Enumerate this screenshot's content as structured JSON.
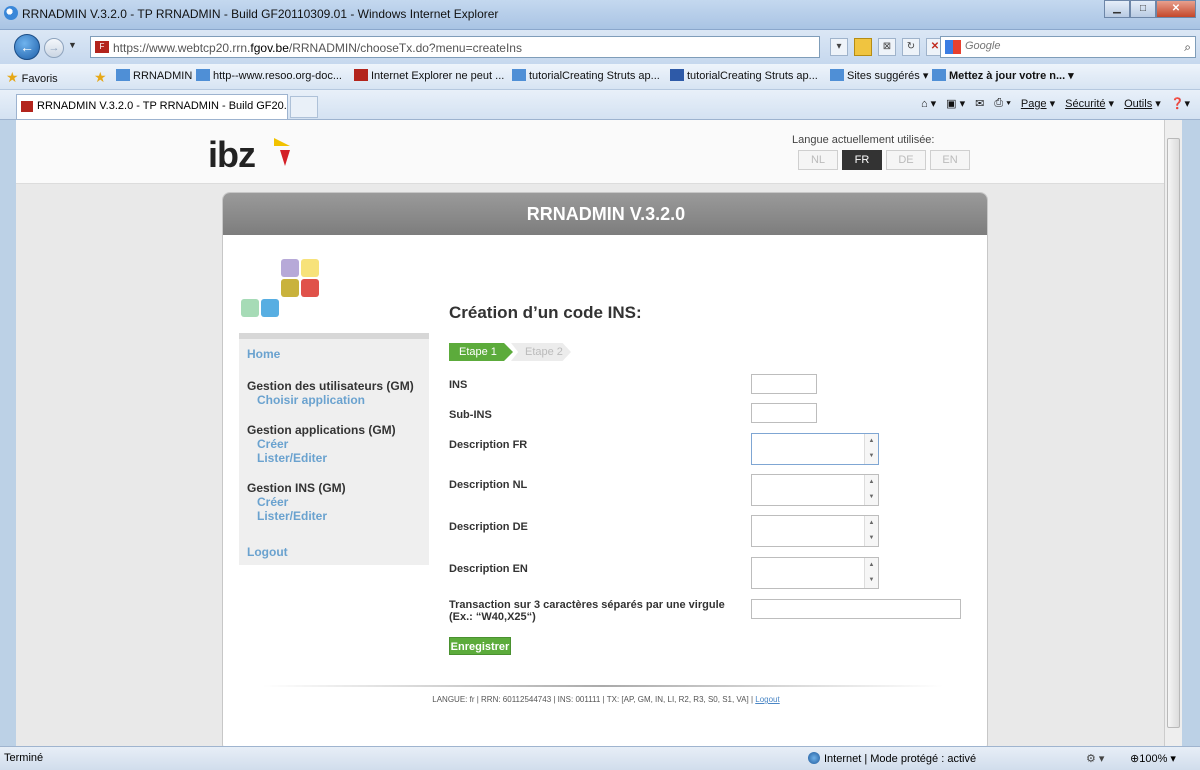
{
  "window": {
    "title": "RRNADMIN V.3.2.0 - TP RRNADMIN - Build GF20110309.01 - Windows Internet Explorer"
  },
  "address": {
    "url_prefix": "https://www.webtcp20.rrn.",
    "url_domain": "fgov.be",
    "url_suffix": "/RRNADMIN/chooseTx.do?menu=createIns",
    "search_placeholder": "Google"
  },
  "favorites": {
    "label": "Favoris",
    "items": [
      "RRNADMIN",
      "http--www.resoo.org-doc...",
      "Internet Explorer ne peut ...",
      "tutorialCreating Struts ap...",
      "tutorialCreating Struts ap...",
      "Sites suggérés ▾",
      "Mettez à jour votre n... ▾"
    ]
  },
  "tab": {
    "label": "RRNADMIN V.3.2.0 - TP RRNADMIN - Build GF20..."
  },
  "commandbar": {
    "page": "Page",
    "security": "Sécurité",
    "tools": "Outils"
  },
  "language": {
    "label": "Langue actuellement utilisée:",
    "options": [
      "NL",
      "FR",
      "DE",
      "EN"
    ],
    "active": "FR"
  },
  "panel": {
    "title": "RRNADMIN V.3.2.0"
  },
  "sidebar": {
    "home": "Home",
    "groups": [
      {
        "heading": "Gestion des utilisateurs (GM)",
        "links": [
          "Choisir application"
        ]
      },
      {
        "heading": "Gestion applications (GM)",
        "links": [
          "Créer",
          "Lister/Editer"
        ]
      },
      {
        "heading": "Gestion INS (GM)",
        "links": [
          "Créer",
          "Lister/Editer"
        ]
      }
    ],
    "logout": "Logout"
  },
  "form": {
    "title": "Création d’un code INS:",
    "steps": [
      "Etape 1",
      "Etape 2"
    ],
    "fields": {
      "ins": {
        "label": "INS",
        "value": ""
      },
      "sub_ins": {
        "label": "Sub-INS",
        "value": ""
      },
      "desc_fr": {
        "label": "Description FR",
        "value": ""
      },
      "desc_nl": {
        "label": "Description NL",
        "value": ""
      },
      "desc_de": {
        "label": "Description DE",
        "value": ""
      },
      "desc_en": {
        "label": "Description EN",
        "value": ""
      },
      "transaction": {
        "label_line1": "Transaction sur 3 caractères séparés par une virgule",
        "label_line2": "(Ex.: “W40,X25“)",
        "value": ""
      }
    },
    "save_label": "Enregistrer"
  },
  "footer": {
    "text": "LANGUE:  fr | RRN:  60112544743 | INS:  001111 | TX: [AP, GM, IN, LI, R2, R3, S0, S1, VA] | ",
    "logout": "Logout"
  },
  "status": {
    "text": "Terminé",
    "zone": "Internet | Mode protégé : activé",
    "zoom": "100%"
  },
  "colors": {
    "accent_green": "#5cab3b",
    "link_blue": "#6aa2cf",
    "header_grey": "#8a8a8a"
  }
}
